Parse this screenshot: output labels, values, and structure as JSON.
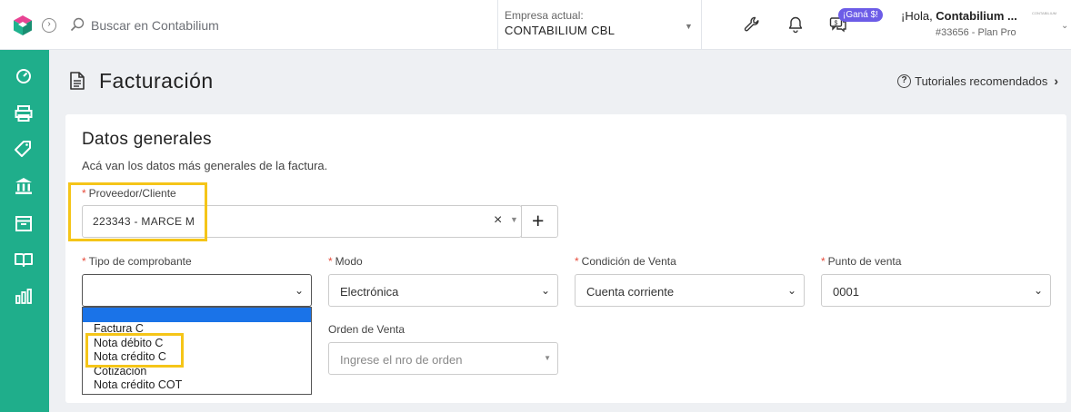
{
  "header": {
    "search_placeholder": "Buscar en Contabilium",
    "company_label": "Empresa actual:",
    "company_name": "CONTABILIUM CBL",
    "promo_badge": "¡Ganá $!",
    "greeting_prefix": "¡Hola, ",
    "greeting_name": "Contabilium ...",
    "plan": "#33656 - Plan Pro",
    "avatar_text": "CONTABILIUM"
  },
  "sidebar": {
    "items": [
      {
        "icon": "dashboard-gauge-icon"
      },
      {
        "icon": "printer-icon"
      },
      {
        "icon": "tag-icon"
      },
      {
        "icon": "bank-icon"
      },
      {
        "icon": "box-icon"
      },
      {
        "icon": "book-icon"
      },
      {
        "icon": "bar-chart-icon"
      }
    ]
  },
  "page": {
    "title": "Facturación",
    "tutorials_link": "Tutoriales recomendados"
  },
  "card": {
    "title": "Datos generales",
    "subtitle": "Acá van los datos más generales de la factura."
  },
  "form": {
    "proveedor_label": "Proveedor/Cliente",
    "proveedor_value": "223343 - MARCE M",
    "clear_symbol": "×",
    "add_symbol": "+",
    "tipo_label": "Tipo de comprobante",
    "tipo_value": "",
    "modo_label": "Modo",
    "modo_value": "Electrónica",
    "condicion_label": "Condición de Venta",
    "condicion_value": "Cuenta corriente",
    "punto_label": "Punto de venta",
    "punto_value": "0001",
    "orden_label": "Orden de Venta",
    "orden_placeholder": "Ingrese el nro de orden"
  },
  "tipo_dropdown": {
    "options": [
      "",
      "Factura C",
      "Nota débito C",
      "Nota crédito C",
      "Cotización",
      "Nota crédito COT"
    ],
    "highlighted_index": 0
  },
  "colors": {
    "brand_green": "#1fae8b",
    "highlight_yellow": "#f5c518",
    "selection_blue": "#1a73e8",
    "required_red": "#e74c3c",
    "badge_purple": "#6c5ce7"
  }
}
